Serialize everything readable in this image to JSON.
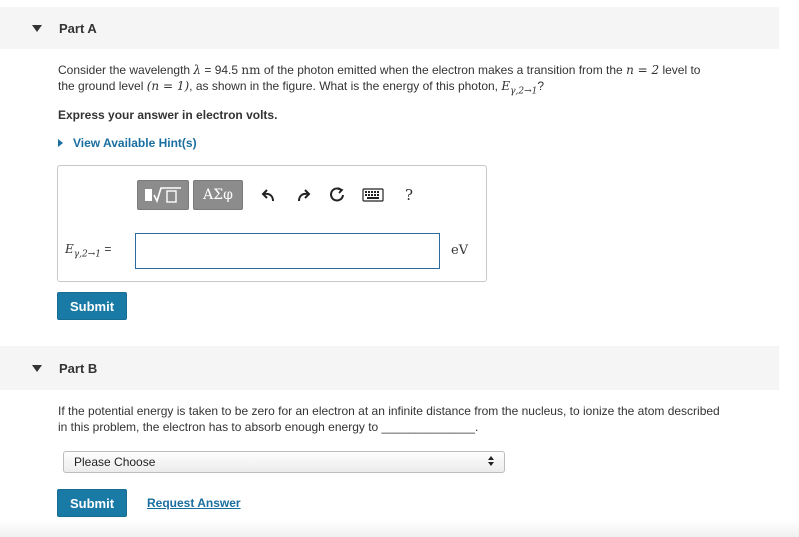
{
  "partA": {
    "title": "Part A",
    "q_text1": "Consider the wavelength ",
    "q_lambda": "λ",
    "q_text2": " = 94.5 ",
    "q_nm": "nm",
    "q_text3": " of the photon emitted when the electron makes a transition from the ",
    "q_n2": "n = 2",
    "q_text4": " level to",
    "q_text5": "the ground level ",
    "q_n1": "(n = 1)",
    "q_text6": ", as shown in the figure. What is the energy of this photon, ",
    "q_E": "E",
    "q_sub": "γ,2→1",
    "q_text7": "?",
    "instruction": "Express your answer in electron volts.",
    "hint": "View Available Hint(s)",
    "toolbar": {
      "sqrt_label": "√",
      "greek_label": "ΑΣφ",
      "help_label": "?"
    },
    "answer_label_E": "E",
    "answer_label_sub": "γ,2→1",
    "answer_label_eq": " =",
    "answer_value": "",
    "unit": "eV",
    "submit": "Submit"
  },
  "partB": {
    "title": "Part B",
    "q_line1": "If the potential energy is taken to be zero for an electron at an infinite distance from the nucleus, to ionize the atom described",
    "q_line2": "in this problem, the electron has to absorb enough energy to",
    "q_blank": "______________",
    "q_end": ".",
    "select_value": "Please Choose",
    "submit": "Submit",
    "request": "Request Answer"
  }
}
